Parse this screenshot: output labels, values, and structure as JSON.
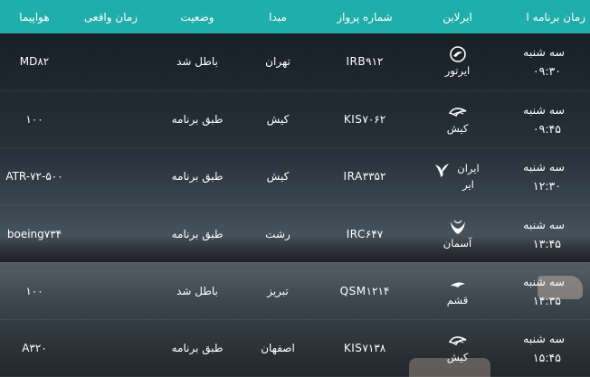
{
  "headers": {
    "time": "زمان برنامه ا",
    "airline": "ایرلاین",
    "flight": "شماره پرواز",
    "origin": "مبدا",
    "status": "وضعیت",
    "actual": "زمان واقعی",
    "aircraft": "هواپیما"
  },
  "rows": [
    {
      "day": "سه شنبه",
      "time": "۰۹:۳۰",
      "airline": "ایرتور",
      "airline_icon": "airtour-logo-icon",
      "flight": "IRB۹۱۲",
      "origin": "تهران",
      "status": "باطل شد",
      "actual": "",
      "aircraft": "MD۸۲"
    },
    {
      "day": "سه شنبه",
      "time": "۰۹:۴۵",
      "airline": "کیش",
      "airline_icon": "kish-air-logo-icon",
      "flight": "KIS۷۰۶۲",
      "origin": "کیش",
      "status": "طبق برنامه",
      "actual": "",
      "aircraft": "۱۰۰"
    },
    {
      "day": "سه شنبه",
      "time": "۱۲:۳۰",
      "airline": "ایران ایر",
      "airline_icon": "iran-air-logo-icon",
      "flight": "IRA۳۳۵۲",
      "origin": "کیش",
      "status": "طبق برنامه",
      "actual": "",
      "aircraft": "ATR-۷۲-۵۰۰"
    },
    {
      "day": "سه شنبه",
      "time": "۱۳:۴۵",
      "airline": "آسمان",
      "airline_icon": "aseman-logo-icon",
      "flight": "IRC۶۴۷",
      "origin": "رشت",
      "status": "طبق برنامه",
      "actual": "",
      "aircraft": "boeing۷۳۴"
    },
    {
      "day": "سه شنبه",
      "time": "۱۴:۳۵",
      "airline": "قشم",
      "airline_icon": "qeshm-air-logo-icon",
      "flight": "QSM۱۲۱۴",
      "origin": "تبریز",
      "status": "باطل شد",
      "actual": "",
      "aircraft": "۱۰۰"
    },
    {
      "day": "سه شنبه",
      "time": "۱۵:۴۵",
      "airline": "کیش",
      "airline_icon": "kish-air-logo-icon",
      "flight": "KIS۷۱۳۸",
      "origin": "اصفهان",
      "status": "طبق برنامه",
      "actual": "",
      "aircraft": "A۳۲۰"
    }
  ]
}
